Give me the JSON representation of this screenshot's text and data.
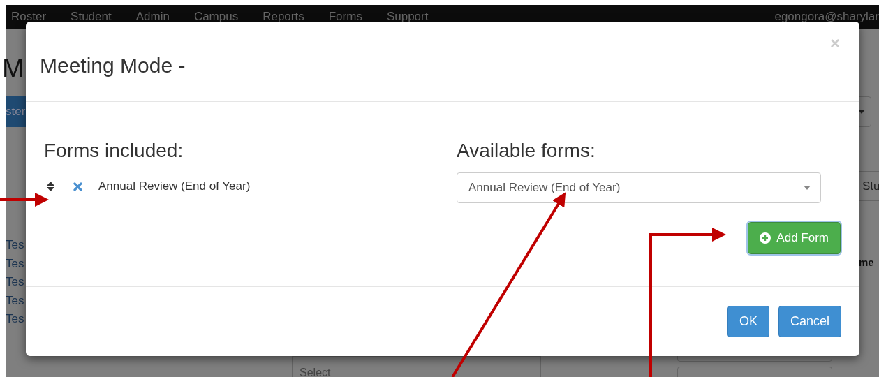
{
  "navbar": {
    "items": [
      "Roster",
      "Student",
      "Admin",
      "Campus",
      "Reports",
      "Forms",
      "Support"
    ],
    "user": "egongora@sharylar"
  },
  "background": {
    "heading": "M",
    "button": "ster",
    "links": [
      "Tes",
      "Tes",
      "Tes",
      "Tes",
      "Tes"
    ],
    "tab": "Stu",
    "label": "me",
    "select": "Select"
  },
  "modal": {
    "title": "Meeting Mode -",
    "close": "×",
    "included": {
      "heading": "Forms included:",
      "items": [
        {
          "name": "Annual Review (End of Year)"
        }
      ]
    },
    "available": {
      "heading": "Available forms:",
      "value": "Annual Review (End of Year)",
      "add_button": "Add Form"
    },
    "buttons": [
      {
        "label": "OK"
      },
      {
        "label": "Cancel"
      }
    ]
  }
}
